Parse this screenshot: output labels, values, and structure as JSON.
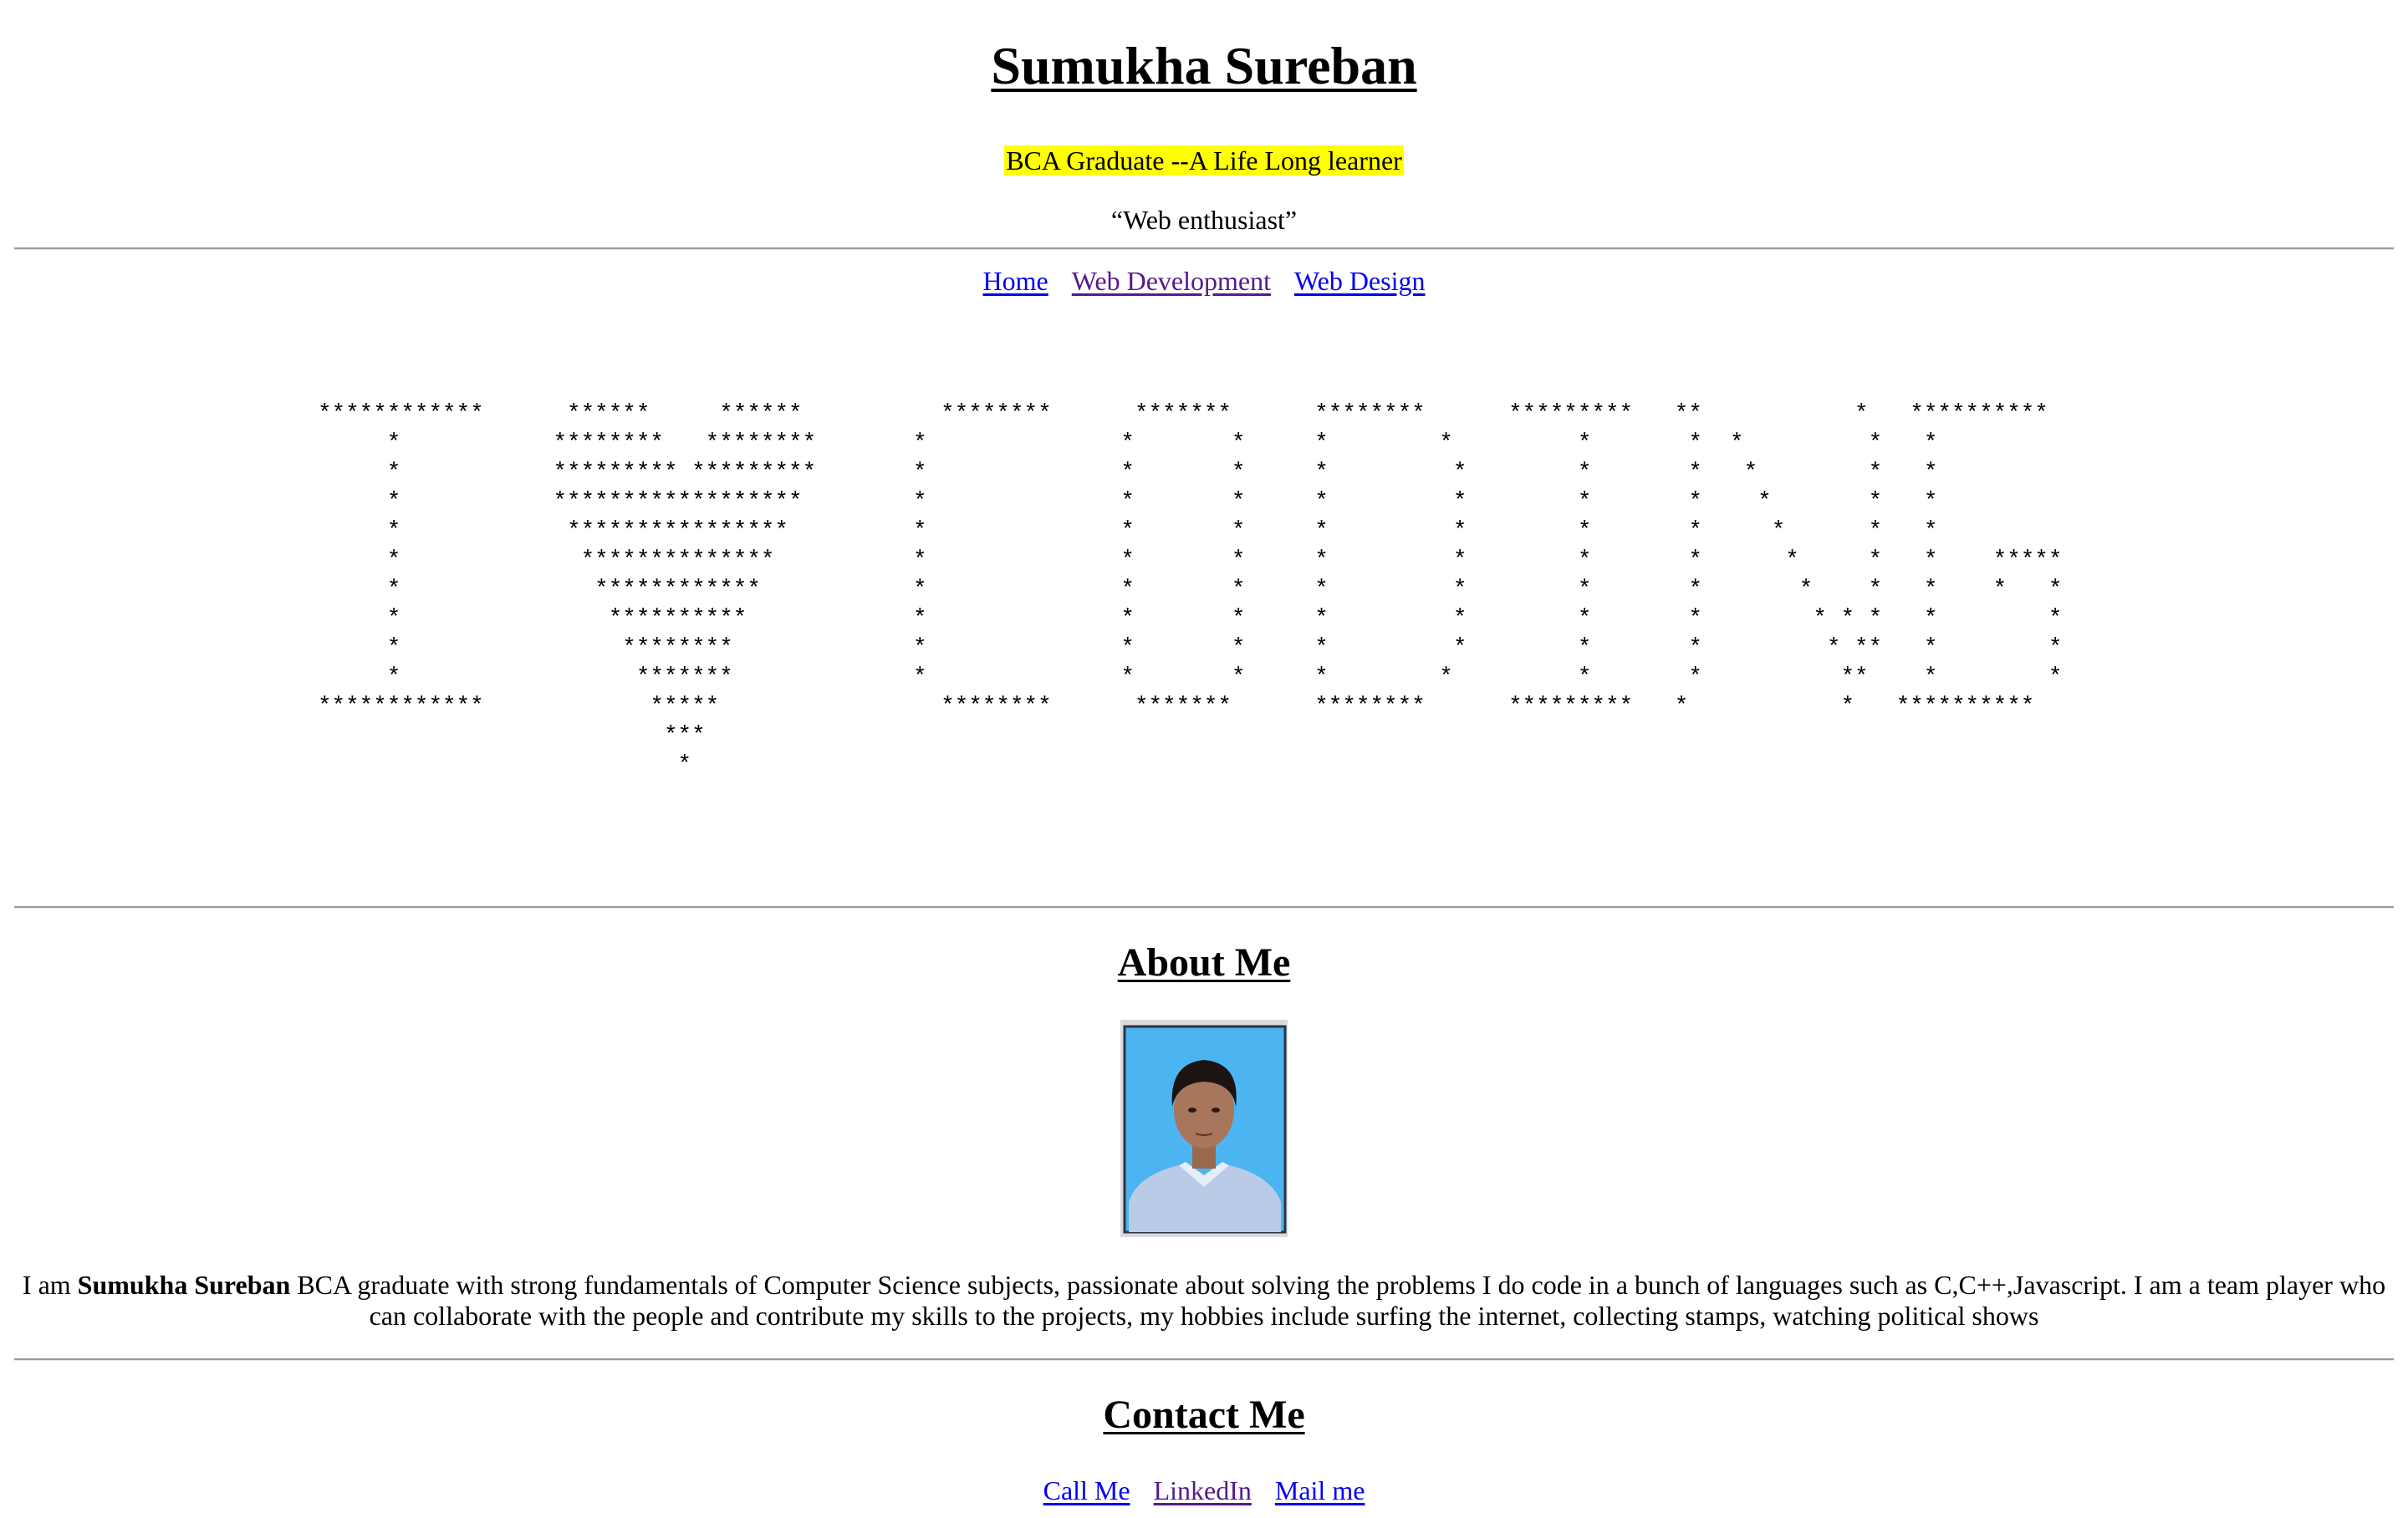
{
  "header": {
    "name": "Sumukha Sureban",
    "tagline": "BCA Graduate --A Life Long learner",
    "quote": "“Web enthusiast”"
  },
  "nav": {
    "home": "Home",
    "web_development": "Web Development",
    "web_design": "Web Design"
  },
  "ascii_art": "************      ******     ******          ********      *******      ********      *********   **           *   **********\n     *           ********   ********       *              *       *     *        *         *       *  *         *   *\n     *           ********* *********       *              *       *     *         *        *       *   *        *   *\n     *           ******************        *              *       *     *         *        *       *    *       *   *\n     *            ****************         *              *       *     *         *        *       *     *      *   *\n     *             **************          *              *       *     *         *        *       *      *     *   *    *****\n     *              ************           *              *       *     *         *        *       *       *    *   *    *   *\n     *               **********            *              *       *     *         *        *       *        * * *   *        *\n     *                ********             *              *       *     *         *        *       *         * **   *        *\n     *                 *******             *              *       *     *        *         *       *          **    *        *\n************            *****                ********      *******      ********      *********   *           *   **********\n                         ***\n                          *",
  "about": {
    "heading": "About Me",
    "photo_alt": "Profile photo",
    "bio_intro": "I am ",
    "bio_name": "Sumukha Sureban",
    "bio_text": " BCA graduate with strong fundamentals of Computer Science subjects, passionate about solving the problems I do code in a bunch of languages such as C,C++,Javascript. I am a team player who can collaborate with the people and contribute my skills to the projects, my hobbies include surfing the internet, collecting stamps, watching political shows"
  },
  "contact": {
    "heading": "Contact Me",
    "call": "Call Me",
    "linkedin": "LinkedIn",
    "mail": "Mail me"
  },
  "colors": {
    "highlight": "#ffff00",
    "link": "#0000ee",
    "visited_link": "#551a8b",
    "photo_background": "#4db4f2"
  }
}
